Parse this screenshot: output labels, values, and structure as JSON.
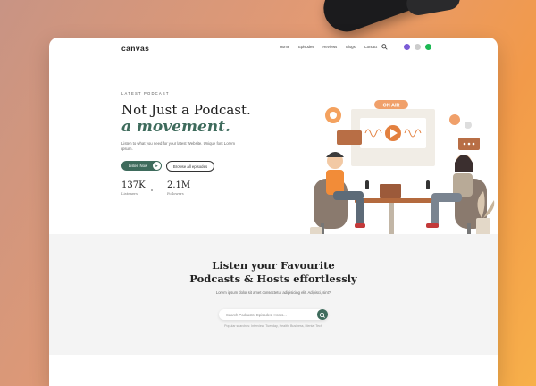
{
  "nav": {
    "logo": "canvas",
    "links": [
      "Home",
      "Episodes",
      "Reviews",
      "Blogs",
      "Contact"
    ]
  },
  "hero": {
    "eyebrow": "LATEST PODCAST",
    "title_line1": "Not Just a Podcast.",
    "title_line2": "a movement.",
    "description": "Listen to what you need for your latest Website. Unique font Lorem ipsum.",
    "primary_button": "Listen Now",
    "secondary_button": "Browse all episodes",
    "stats": [
      {
        "value": "137K",
        "label": "Listeners"
      },
      {
        "value": "2.1M",
        "label": "Followers"
      }
    ],
    "illustration_badge": "ON AIR"
  },
  "search_section": {
    "title_line1": "Listen your Favourite",
    "title_line2": "Podcasts & Hosts effortlessly",
    "subtitle": "Lorem ipsum dolor sit amet consectetur adipisicing elit. Adipisci, sint?",
    "search_placeholder": "Search Podcasts, Episodes, Hosts...",
    "tags_text": "Popular searches: Interview, Tuesday, Health, Business, Mental Tech"
  },
  "colors": {
    "brand_green": "#3e6b5c",
    "accent_orange": "#e3803f"
  }
}
